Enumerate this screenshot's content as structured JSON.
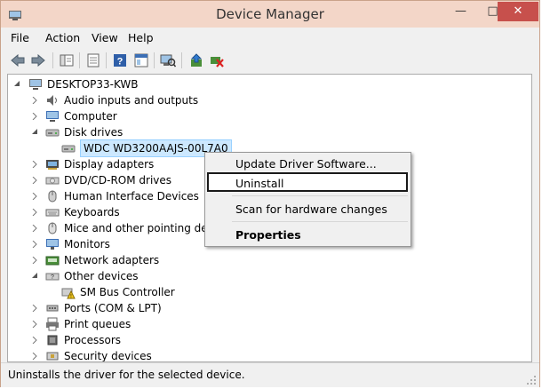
{
  "window": {
    "title": "Device Manager",
    "controls": {
      "minimize": "—",
      "maximize": "□",
      "close": "✕"
    }
  },
  "menu": [
    "File",
    "Action",
    "View",
    "Help"
  ],
  "toolbar_icons": [
    "back-icon",
    "forward-icon",
    "show-hide-tree-icon",
    "properties-icon",
    "help-icon",
    "view-icon",
    "scan-hardware-icon",
    "update-driver-icon",
    "uninstall-icon"
  ],
  "tree": {
    "root": "DESKTOP33-KWB",
    "items": [
      {
        "label": "Audio inputs and outputs",
        "icon": "speaker-icon",
        "state": "collapsed",
        "level": 1
      },
      {
        "label": "Computer",
        "icon": "computer-icon",
        "state": "collapsed",
        "level": 1
      },
      {
        "label": "Disk drives",
        "icon": "disk-drive-icon",
        "state": "expanded",
        "level": 1
      },
      {
        "label": "WDC WD3200AAJS-00L7A0",
        "icon": "disk-drive-icon",
        "state": "leaf",
        "level": 2,
        "selected": true
      },
      {
        "label": "Display adapters",
        "icon": "display-adapter-icon",
        "state": "collapsed",
        "level": 1
      },
      {
        "label": "DVD/CD-ROM drives",
        "icon": "dvd-drive-icon",
        "state": "collapsed",
        "level": 1
      },
      {
        "label": "Human Interface Devices",
        "icon": "hid-icon",
        "state": "collapsed",
        "level": 1
      },
      {
        "label": "Keyboards",
        "icon": "keyboard-icon",
        "state": "collapsed",
        "level": 1
      },
      {
        "label": "Mice and other pointing devic",
        "icon": "mouse-icon",
        "state": "collapsed",
        "level": 1
      },
      {
        "label": "Monitors",
        "icon": "monitor-icon",
        "state": "collapsed",
        "level": 1
      },
      {
        "label": "Network adapters",
        "icon": "network-adapter-icon",
        "state": "collapsed",
        "level": 1
      },
      {
        "label": "Other devices",
        "icon": "other-devices-icon",
        "state": "expanded",
        "level": 1
      },
      {
        "label": "SM Bus Controller",
        "icon": "warning-device-icon",
        "state": "leaf",
        "level": 2
      },
      {
        "label": "Ports (COM & LPT)",
        "icon": "port-icon",
        "state": "collapsed",
        "level": 1
      },
      {
        "label": "Print queues",
        "icon": "printer-icon",
        "state": "collapsed",
        "level": 1
      },
      {
        "label": "Processors",
        "icon": "processor-icon",
        "state": "collapsed",
        "level": 1
      },
      {
        "label": "Security devices",
        "icon": "security-icon",
        "state": "collapsed",
        "level": 1
      }
    ]
  },
  "context_menu": {
    "update": "Update Driver Software...",
    "uninstall": "Uninstall",
    "scan": "Scan for hardware changes",
    "properties": "Properties"
  },
  "status": "Uninstalls the driver for the selected device.",
  "colors": {
    "titlebar": "#f3d6c8",
    "close": "#c7504c",
    "selection": "#cce8ff"
  }
}
